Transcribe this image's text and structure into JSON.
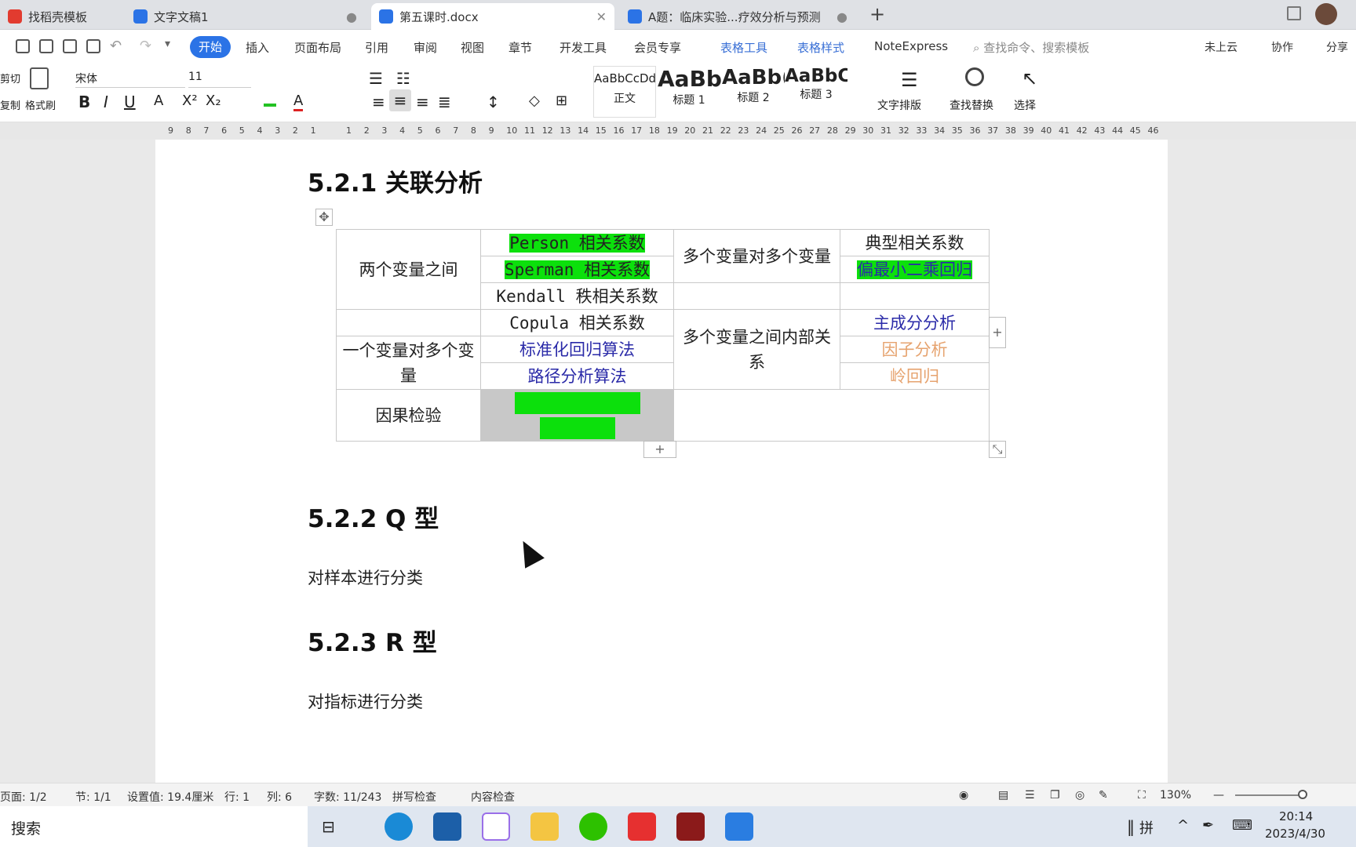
{
  "tabs": [
    {
      "label": "找稻壳模板"
    },
    {
      "label": "文字文稿1"
    },
    {
      "label": "第五课时.docx"
    },
    {
      "label": "A题：临床实验...疗效分析与预测"
    }
  ],
  "menu": {
    "start": "开始",
    "insert": "插入",
    "layout": "页面布局",
    "ref": "引用",
    "review": "审阅",
    "view": "视图",
    "chapter": "章节",
    "dev": "开发工具",
    "vip": "会员专享",
    "table_tools": "表格工具",
    "table_style": "表格样式",
    "noteexpress": "NoteExpress",
    "search_placeholder": "查找命令、搜索模板",
    "cloud": "未上云",
    "collab": "协作",
    "share": "分享"
  },
  "ribbon": {
    "cut": "剪切",
    "copy": "复制",
    "format_painter": "格式刷",
    "font": "宋体",
    "size": "11",
    "styles": [
      {
        "preview": "AaBbCcDd",
        "name": "正文"
      },
      {
        "preview": "AaBb",
        "name": "标题 1"
      },
      {
        "preview": "AaBb(",
        "name": "标题 2"
      },
      {
        "preview": "AaBbC",
        "name": "标题 3"
      }
    ],
    "text_layout": "文字排版",
    "find_replace": "查找替换",
    "select": "选择"
  },
  "ruler": [
    "9",
    "8",
    "7",
    "6",
    "5",
    "4",
    "3",
    "2",
    "1",
    "",
    "1",
    "2",
    "3",
    "4",
    "5",
    "6",
    "7",
    "8",
    "9",
    "10",
    "11",
    "12",
    "13",
    "14",
    "15",
    "16",
    "17",
    "18",
    "19",
    "20",
    "21",
    "22",
    "23",
    "24",
    "25",
    "26",
    "27",
    "28",
    "29",
    "30",
    "31",
    "32",
    "33",
    "34",
    "35",
    "36",
    "37",
    "38",
    "39",
    "40",
    "41",
    "42",
    "43",
    "44",
    "45",
    "46"
  ],
  "doc": {
    "h_521": "5.2.1  关联分析",
    "h_522": "5.2.2 Q 型",
    "p_522": "对样本进行分类",
    "h_523": "5.2.3 R 型",
    "p_523": "对指标进行分类",
    "table": {
      "two_vars": "两个变量之间",
      "person": "Person 相关系数",
      "sperman": "Sperman 相关系数",
      "kendall": "Kendall 秩相关系数",
      "copula": "Copula 相关系数",
      "multi_multi": "多个变量对多个变量",
      "cca": "典型相关系数",
      "pls": "偏最小二乘回归",
      "one_multi": "一个变量对多个变量",
      "std_reg": "标准化回归算法",
      "path": "路径分析算法",
      "multi_internal": "多个变量之间内部关系",
      "pca": "主成分分析",
      "factor": "因子分析",
      "ridge": "岭回归",
      "causal": "因果检验"
    }
  },
  "status": {
    "page": "页面: 1/2",
    "section": "节: 1/1",
    "setting": "设置值: 19.4厘米",
    "row": "行: 1",
    "col": "列: 6",
    "words": "字数: 11/243",
    "spell": "拼写检查",
    "content": "内容检查",
    "zoom": "130%"
  },
  "taskbar": {
    "search": "搜索",
    "time": "20:14",
    "date": "2023/4/30",
    "ime": "拼"
  }
}
